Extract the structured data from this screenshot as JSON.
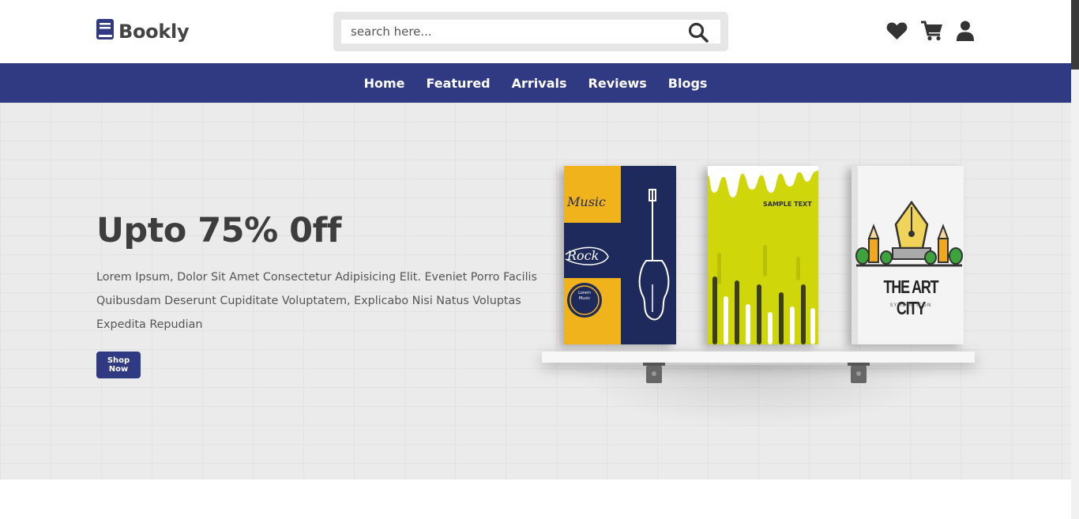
{
  "brand": {
    "name": "Bookly",
    "icon": "book-icon"
  },
  "search": {
    "placeholder": "search here...",
    "icon": "search-icon"
  },
  "header_icons": [
    "heart-icon",
    "cart-icon",
    "user-icon"
  ],
  "nav": {
    "items": [
      "Home",
      "Featured",
      "Arrivals",
      "Reviews",
      "Blogs"
    ]
  },
  "hero": {
    "title": "Upto 75% 0ff",
    "text": "Lorem Ipsum, Dolor Sit Amet Consectetur Adipisicing Elit. Eveniet Porro Facilis Quibusdam Deserunt Cupiditate Voluptatem, Explicabo Nisi Natus Voluptas Expedita Repudian",
    "button": "Shop Now"
  },
  "books": [
    {
      "labels": [
        "Music",
        "Rock",
        "Lorem Music"
      ]
    },
    {
      "labels": [
        "SAMPLE TEXT"
      ]
    },
    {
      "labels": [
        "THE ART CITY",
        "SYMBOL ICON"
      ]
    }
  ],
  "colors": {
    "accent": "#2f3a82",
    "text_dark": "#3d3d3d",
    "hero_bg": "#ebebeb",
    "book_yellow": "#f1b31c",
    "book_navy": "#1f2a5c",
    "book_lime": "#cfd60a"
  }
}
